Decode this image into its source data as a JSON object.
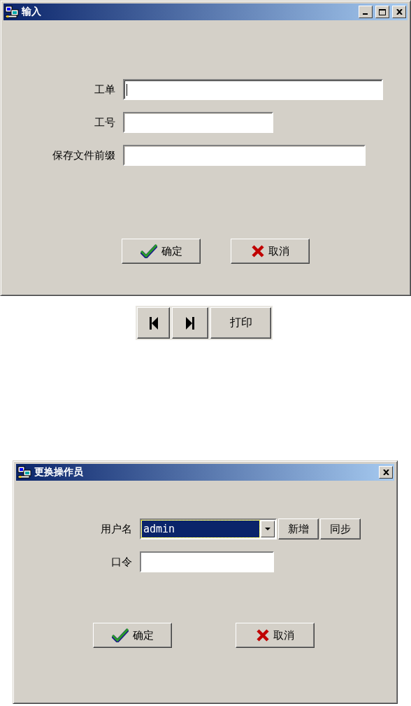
{
  "input_dialog": {
    "title": "输入",
    "controls": [
      {
        "kind": "minimize"
      },
      {
        "kind": "maximize"
      },
      {
        "kind": "close"
      }
    ],
    "fields": [
      {
        "label": "工单",
        "focused": true
      },
      {
        "label": "工号",
        "focused": false
      },
      {
        "label": "保存文件前缀",
        "focused": false
      }
    ],
    "buttons": [
      {
        "label": "确定",
        "kind": "ok"
      },
      {
        "label": "取消",
        "kind": "cancel"
      }
    ]
  },
  "toolbar": [
    {
      "kind": "first"
    },
    {
      "kind": "last"
    },
    {
      "kind": "text",
      "label": "打印"
    }
  ],
  "operator_dialog": {
    "title": "更换操作员",
    "controls": [
      {
        "kind": "close"
      }
    ],
    "username": {
      "label": "用户名",
      "value": "admin",
      "selected": true
    },
    "side_buttons": [
      "新增",
      "同步"
    ],
    "password": {
      "label": "口令"
    },
    "buttons": [
      {
        "label": "确定",
        "kind": "ok"
      },
      {
        "label": "取消",
        "kind": "cancel"
      }
    ]
  }
}
